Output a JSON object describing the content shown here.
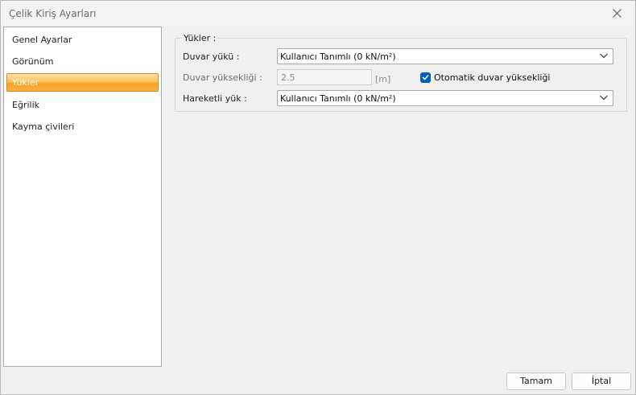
{
  "window": {
    "title": "Çelik Kiriş Ayarları",
    "close_icon": "close-icon"
  },
  "sidebar": {
    "items": [
      {
        "label": "Genel Ayarlar",
        "selected": false
      },
      {
        "label": "Görünüm",
        "selected": false
      },
      {
        "label": "Yükler",
        "selected": true
      },
      {
        "label": "Eğrilik",
        "selected": false
      },
      {
        "label": "Kayma çivileri",
        "selected": false
      }
    ]
  },
  "loads": {
    "group_title": "Yükler :",
    "wall_load": {
      "label": "Duvar yükü :",
      "value": "Kullanıcı Tanımlı (0 kN/m²)"
    },
    "wall_height": {
      "label": "Duvar yüksekliği :",
      "value": "2.5",
      "unit": "[m]"
    },
    "auto_wall_height": {
      "label": "Otomatik duvar yüksekliği",
      "checked": true
    },
    "live_load": {
      "label": "Hareketli yük :",
      "value": "Kullanıcı Tanımlı (0 kN/m²)"
    }
  },
  "footer": {
    "ok_label": "Tamam",
    "cancel_label": "İptal"
  },
  "colors": {
    "selection_accent": "#f9a227",
    "checkbox_accent": "#005fb8"
  }
}
